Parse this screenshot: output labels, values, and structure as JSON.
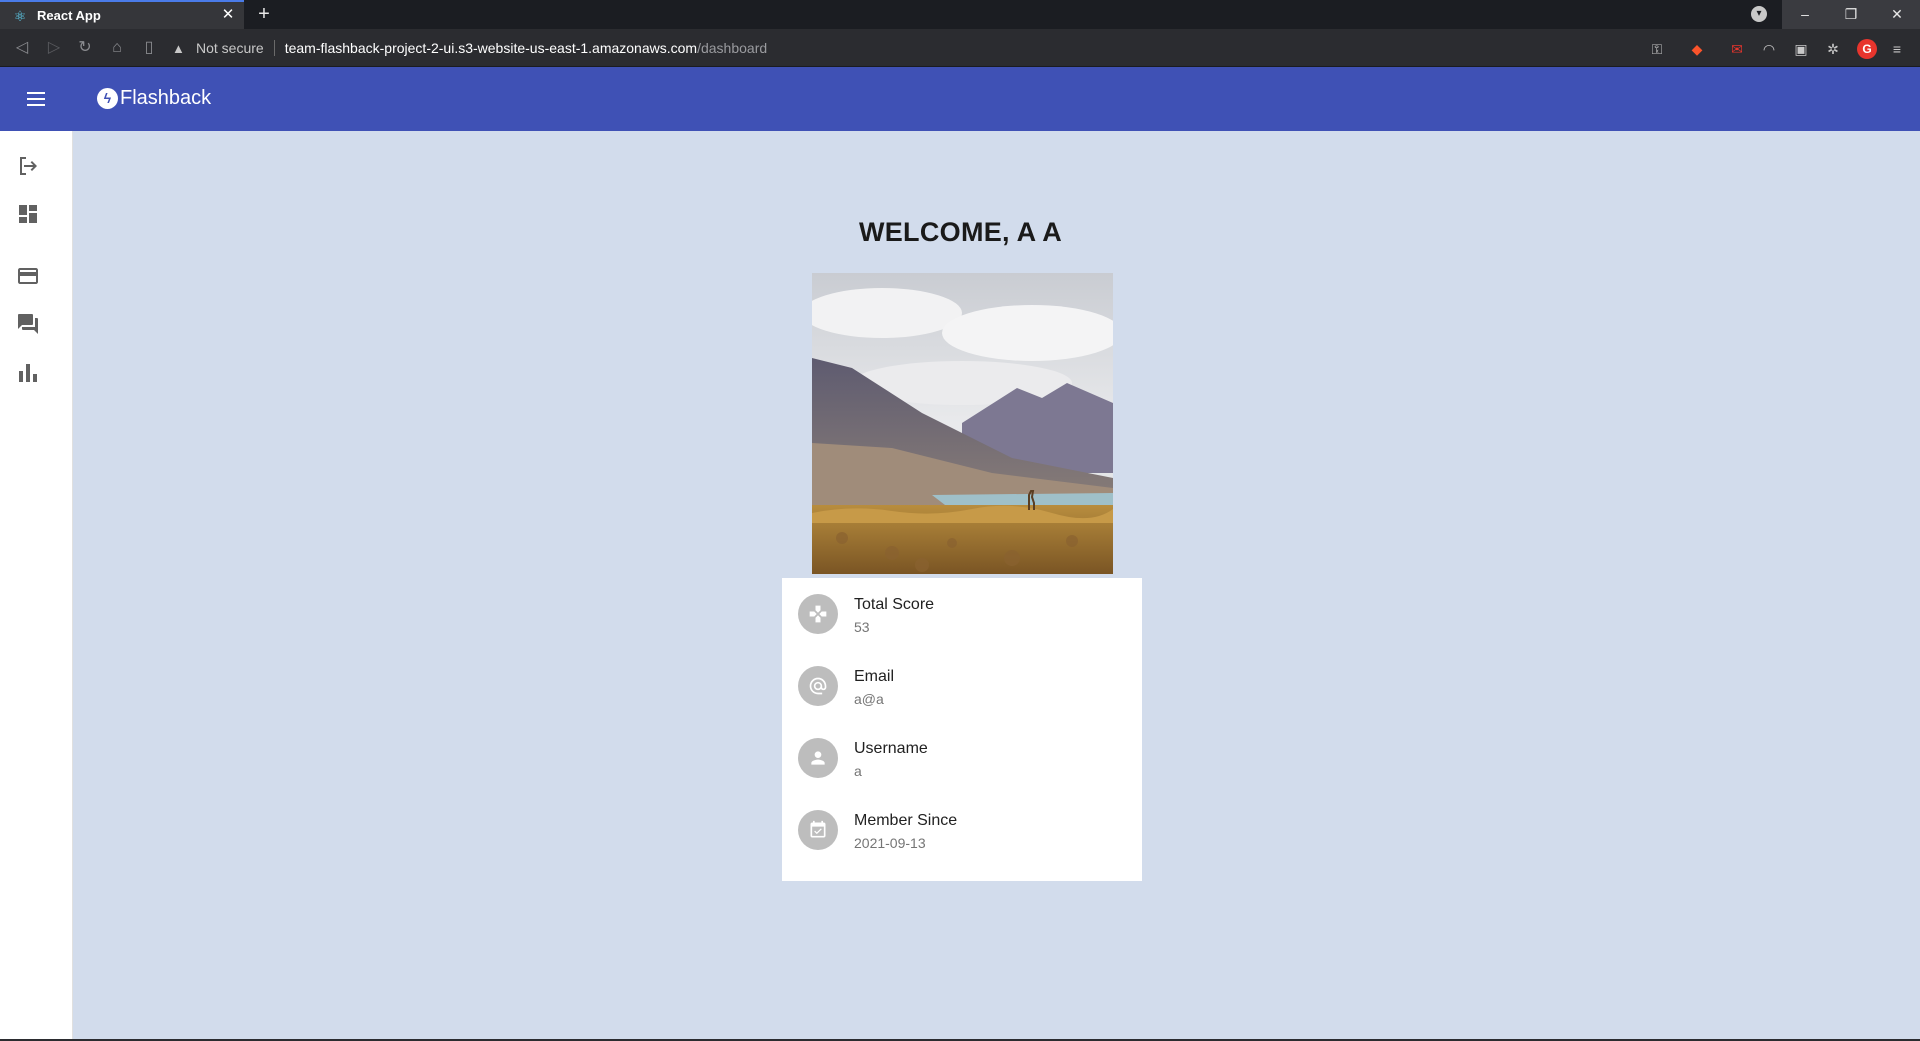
{
  "browser": {
    "tab_title": "React App",
    "tab_favicon": "react-icon",
    "security_label": "Not secure",
    "url_host": "team-flashback-project-2-ui.s3-website-us-east-1.amazonaws.com",
    "url_path": "/dashboard",
    "profile_initial": "G"
  },
  "appbar": {
    "brand": "Flashback",
    "color": "#3f51b5"
  },
  "sidebar": {
    "items": [
      {
        "icon": "logout-icon"
      },
      {
        "icon": "dashboard-icon"
      },
      {
        "icon": "credit-card-icon"
      },
      {
        "icon": "forum-icon"
      },
      {
        "icon": "bar-chart-icon"
      }
    ]
  },
  "main": {
    "welcome": "WELCOME, A A",
    "background": "#d2dcec",
    "profile_image": "mountain-lake-landscape-with-llama",
    "info": [
      {
        "icon": "gamepad-icon",
        "label": "Total Score",
        "value": "53"
      },
      {
        "icon": "at-sign-icon",
        "label": "Email",
        "value": "a@a"
      },
      {
        "icon": "person-icon",
        "label": "Username",
        "value": "a"
      },
      {
        "icon": "calendar-check-icon",
        "label": "Member Since",
        "value": "2021-09-13"
      }
    ]
  }
}
